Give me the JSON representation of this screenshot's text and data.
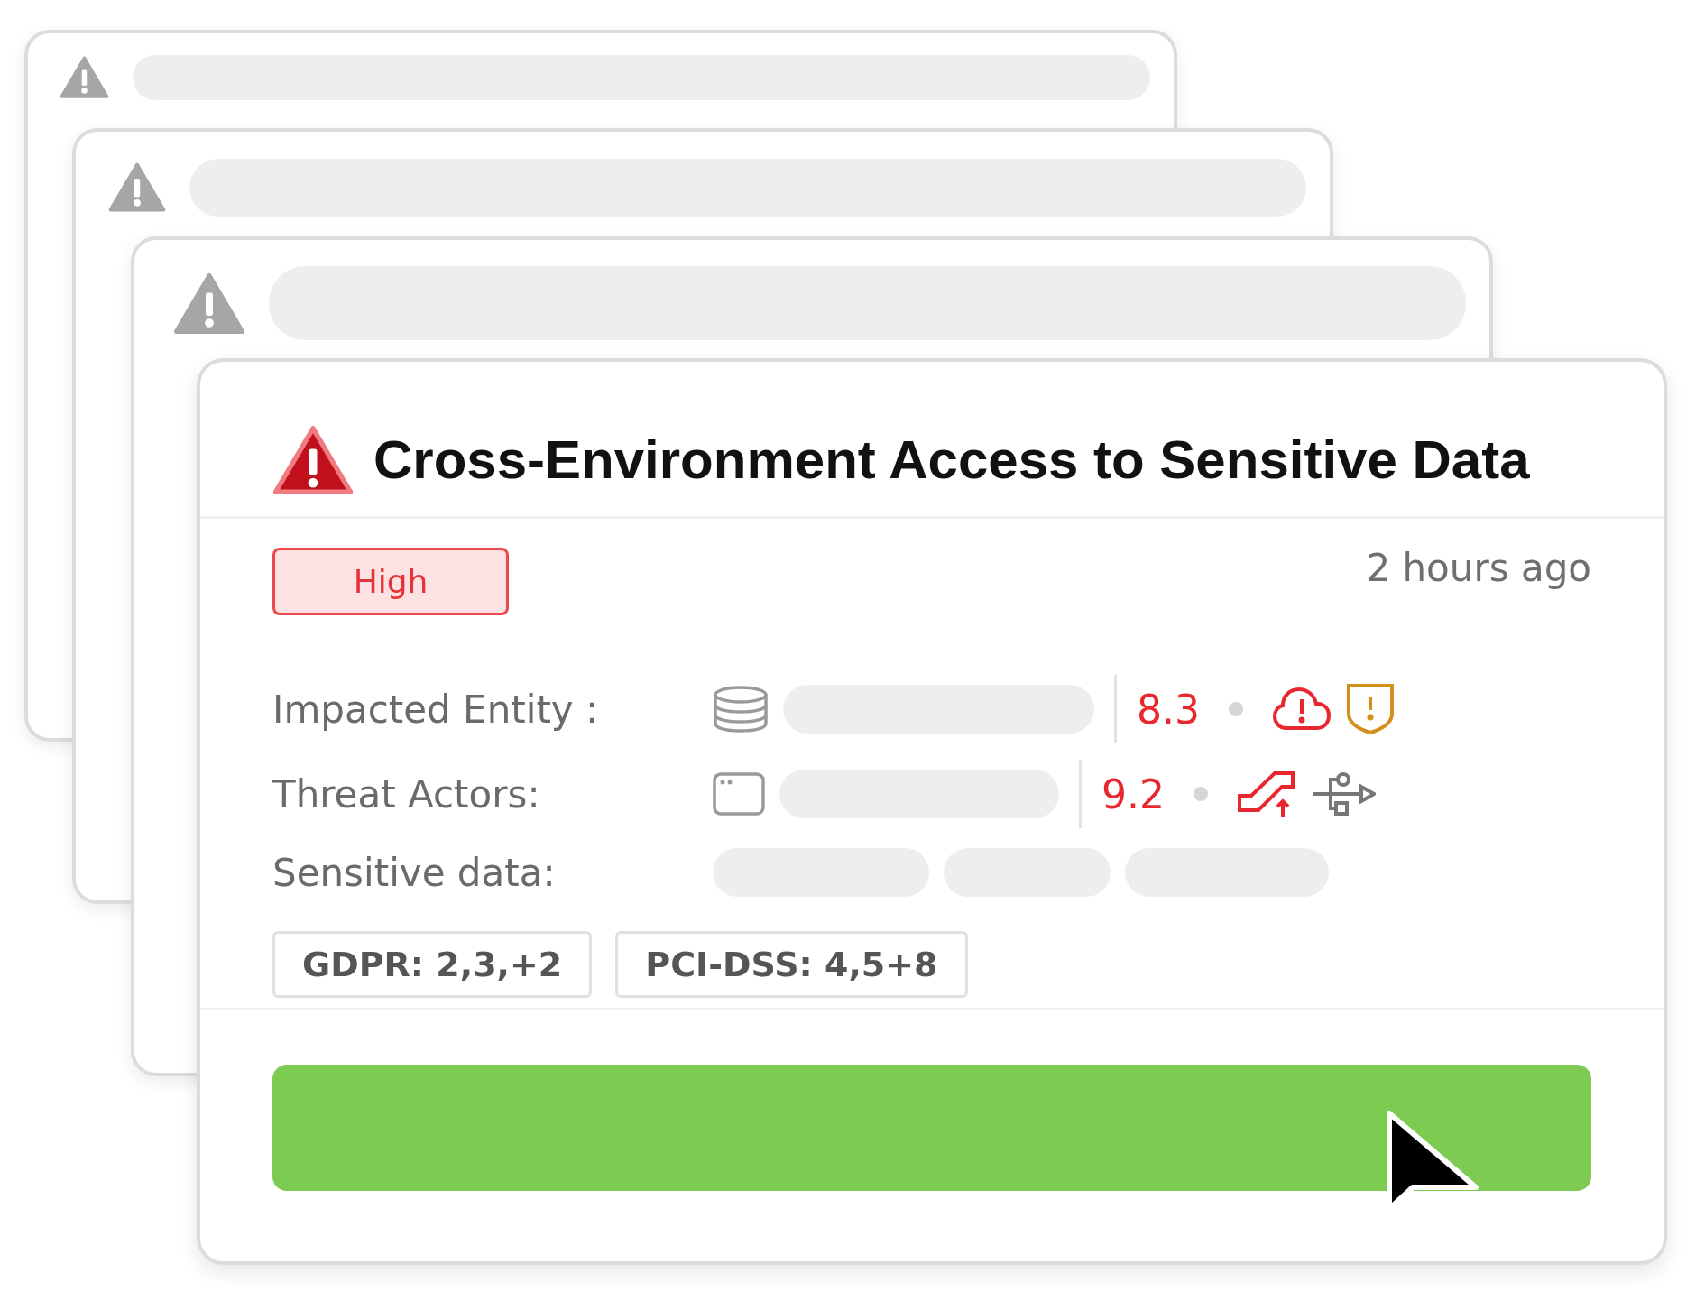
{
  "stacked_cards": [
    {
      "kind": "placeholder"
    },
    {
      "kind": "placeholder"
    },
    {
      "kind": "placeholder"
    }
  ],
  "alert": {
    "title": "Cross-Environment Access to Sensitive Data",
    "severity": {
      "label": "High",
      "kind": "high"
    },
    "time": "2 hours ago",
    "rows": [
      {
        "label": "Impacted Entity :",
        "kind": "entity",
        "score": "8.3",
        "indicators": [
          {
            "color": "#e8282e"
          },
          {
            "color": "#d4901c"
          }
        ]
      },
      {
        "label": "Threat Actors:",
        "kind": "actor",
        "score": "9.2",
        "indicators": [
          {
            "color": "#e8282e"
          },
          {
            "color": "#777777"
          }
        ]
      },
      {
        "label": "Sensitive data:",
        "kind": "data"
      }
    ],
    "tags": [
      "GDPR: 2,3,+2",
      "PCI-DSS: 4,5+8"
    ]
  }
}
